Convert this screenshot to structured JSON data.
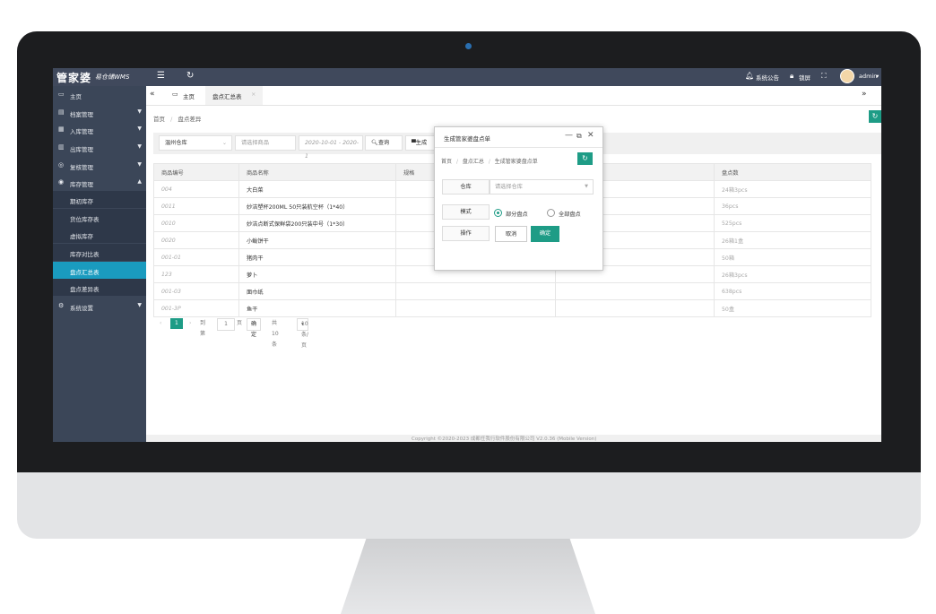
{
  "app": {
    "logo": "管家婆",
    "logo_sub": "易仓储WMS",
    "notice": "系统公告",
    "lock": "锁屏",
    "user": "admin"
  },
  "sidebar": {
    "items": [
      {
        "label": "主页",
        "icon": "monitor-icon"
      },
      {
        "label": "档案管理",
        "icon": "archive-icon"
      },
      {
        "label": "入库管理",
        "icon": "inbound-icon"
      },
      {
        "label": "出库管理",
        "icon": "outbound-icon"
      },
      {
        "label": "复核管理",
        "icon": "review-icon"
      },
      {
        "label": "库存管理",
        "icon": "inventory-icon"
      }
    ],
    "sub_items": [
      "期初库存",
      "货位库存表",
      "虚拟库存",
      "库存对比表",
      "盘点汇总表",
      "盘点差异表"
    ],
    "settings": "系统设置"
  },
  "tabs": {
    "home": "主页",
    "active": "盘点汇总表"
  },
  "breadcrumb": {
    "home": "首页",
    "current": "盘点差异"
  },
  "filter": {
    "warehouse": "温州仓库",
    "product_placeholder": "请选择商品",
    "date_range": "2020-10-01 - 2020-1",
    "query_button": "查询",
    "generate_button": "生成"
  },
  "table": {
    "headers": [
      "商品编号",
      "商品名称",
      "规格",
      "",
      "盘点数"
    ],
    "rows": [
      {
        "code": "004",
        "name": "大白菜",
        "count": "24箱3pcs"
      },
      {
        "code": "0011",
        "name": "妙洁塑杯200ML 50只装航空杯（1*40）",
        "count": "36pcs"
      },
      {
        "code": "0010",
        "name": "妙洁点断式保鲜袋200只装中号（1*30）",
        "count": "525pcs"
      },
      {
        "code": "0020",
        "name": "小鲅饼干",
        "count": "26箱1盒"
      },
      {
        "code": "001-01",
        "name": "猪肉干",
        "count": "50箱"
      },
      {
        "code": "123",
        "name": "萝卜",
        "count": "26箱3pcs"
      },
      {
        "code": "001-03",
        "name": "面巾纸",
        "count": "638pcs"
      },
      {
        "code": "001-3P",
        "name": "鱼干",
        "count": "50盒"
      }
    ]
  },
  "pager": {
    "current": "1",
    "goto": "到第",
    "page_input": "1",
    "page_unit": "页",
    "confirm": "确定",
    "total": "共 10 条",
    "per_page": "10 条/页"
  },
  "footer": {
    "copyright": "Copyright ©2020-2023 成都任我行软件股份有限公司 V2.0.36 (Mobile Version)"
  },
  "dialog": {
    "title": "生成管家婆盘点单",
    "crumbs": [
      "首页",
      "盘点汇总",
      "生成管家婆盘点单"
    ],
    "warehouse_label": "仓库",
    "warehouse_placeholder": "请选择仓库",
    "mode_label": "模式",
    "mode_partial": "部分盘点",
    "mode_full": "全部盘点",
    "action_label": "操作",
    "cancel": "取消",
    "ok": "确定"
  },
  "colors": {
    "accent": "#1e9c86",
    "sidebar": "#3b4658",
    "sidebar_active": "#1a9bbf",
    "topbar": "#40495c"
  }
}
